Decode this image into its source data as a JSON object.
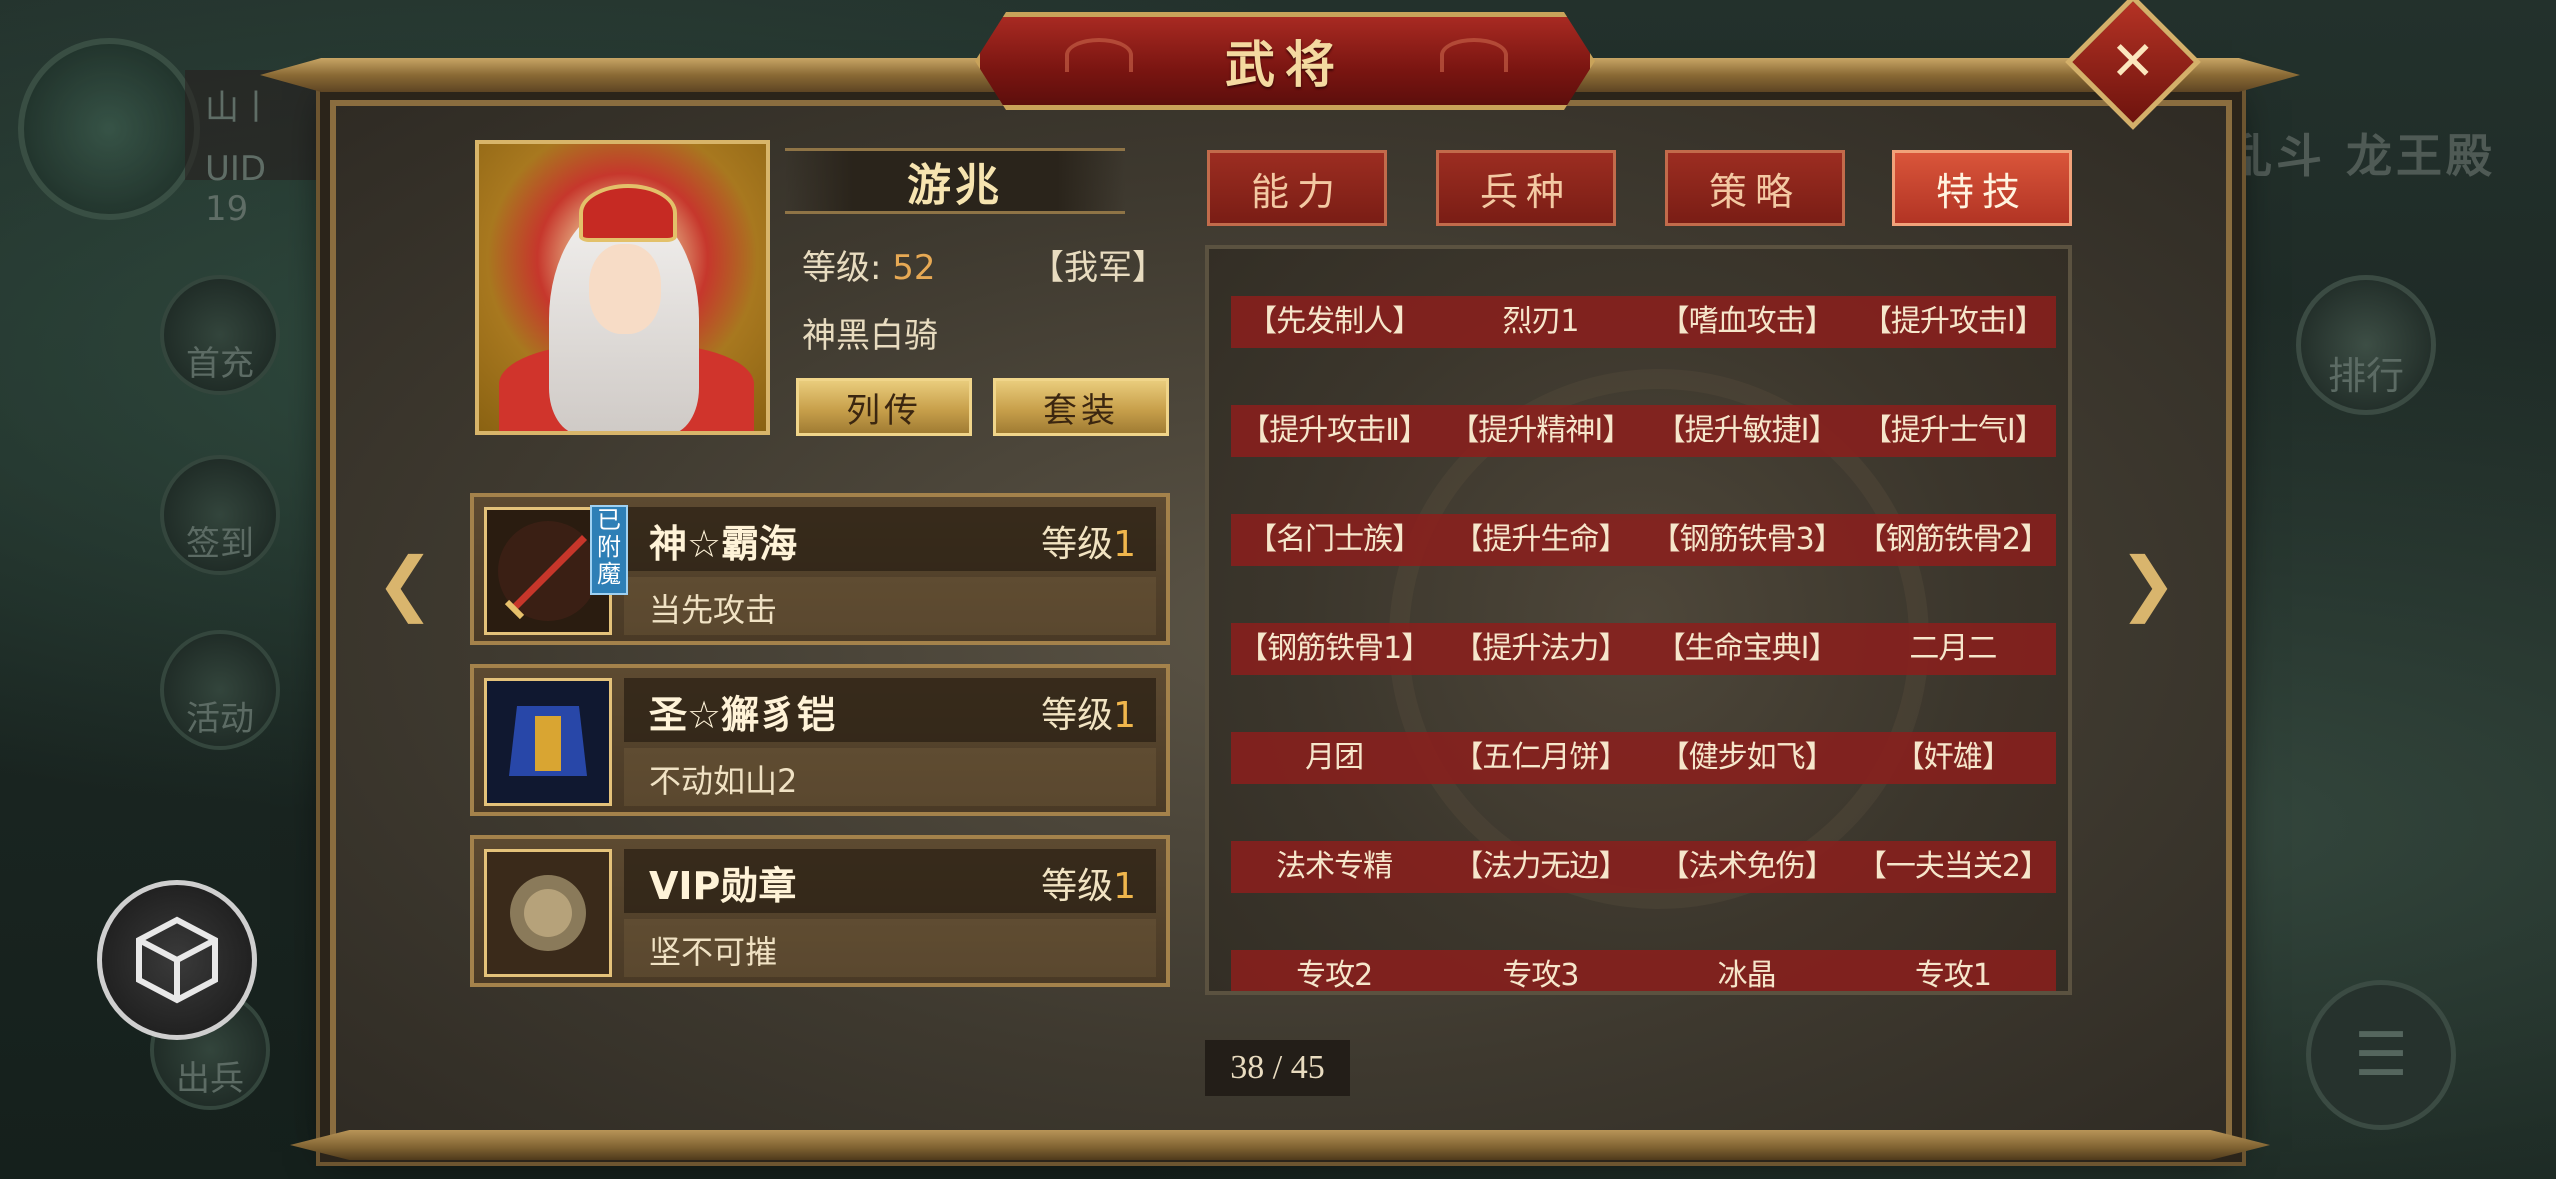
{
  "background": {
    "server_label": "山丨",
    "uid_label": "UID 19",
    "side_buttons": [
      "首充",
      "签到",
      "活动",
      "出兵"
    ],
    "right_title": "乱斗 龙王殿",
    "rank_label": "排行"
  },
  "dialog": {
    "title": "武将",
    "close_symbol": "✕"
  },
  "hero": {
    "name": "游兆",
    "level_label": "等级:",
    "level_value": "52",
    "faction": "【我军】",
    "unit_type": "神黑白骑",
    "biography_button": "列传",
    "set_button": "套装"
  },
  "equipment": [
    {
      "name": "神☆霸海",
      "level_label": "等级",
      "level": "1",
      "skill": "当先攻击",
      "badge": "已附魔"
    },
    {
      "name": "圣☆獬豸铠",
      "level_label": "等级",
      "level": "1",
      "skill": "不动如山2"
    },
    {
      "name": "VIP勋章",
      "level_label": "等级",
      "level": "1",
      "skill": "坚不可摧"
    }
  ],
  "tabs": [
    "能力",
    "兵种",
    "策略",
    "特技"
  ],
  "active_tab": "特技",
  "skill_rows": [
    [
      "【先发制人】",
      "烈刃1",
      "【嗜血攻击】",
      "【提升攻击Ⅰ】"
    ],
    [
      "【提升攻击Ⅱ】",
      "【提升精神Ⅰ】",
      "【提升敏捷Ⅰ】",
      "【提升士气Ⅰ】"
    ],
    [
      "【名门士族】",
      "【提升生命】",
      "【钢筋铁骨3】",
      "【钢筋铁骨2】"
    ],
    [
      "【钢筋铁骨1】",
      "【提升法力】",
      "【生命宝典Ⅰ】",
      "二月二"
    ],
    [
      "月团",
      "【五仁月饼】",
      "【健步如飞】",
      "【奸雄】"
    ],
    [
      "法术专精",
      "【法力无边】",
      "【法术免伤】",
      "【一夫当关2】"
    ],
    [
      "专攻2",
      "专攻3",
      "冰晶",
      "专攻1"
    ]
  ],
  "pagination": "38 / 45",
  "colors": {
    "accent_red": "#9c2d21",
    "gold": "#d9b56d",
    "level_number": "#f0b64c"
  }
}
